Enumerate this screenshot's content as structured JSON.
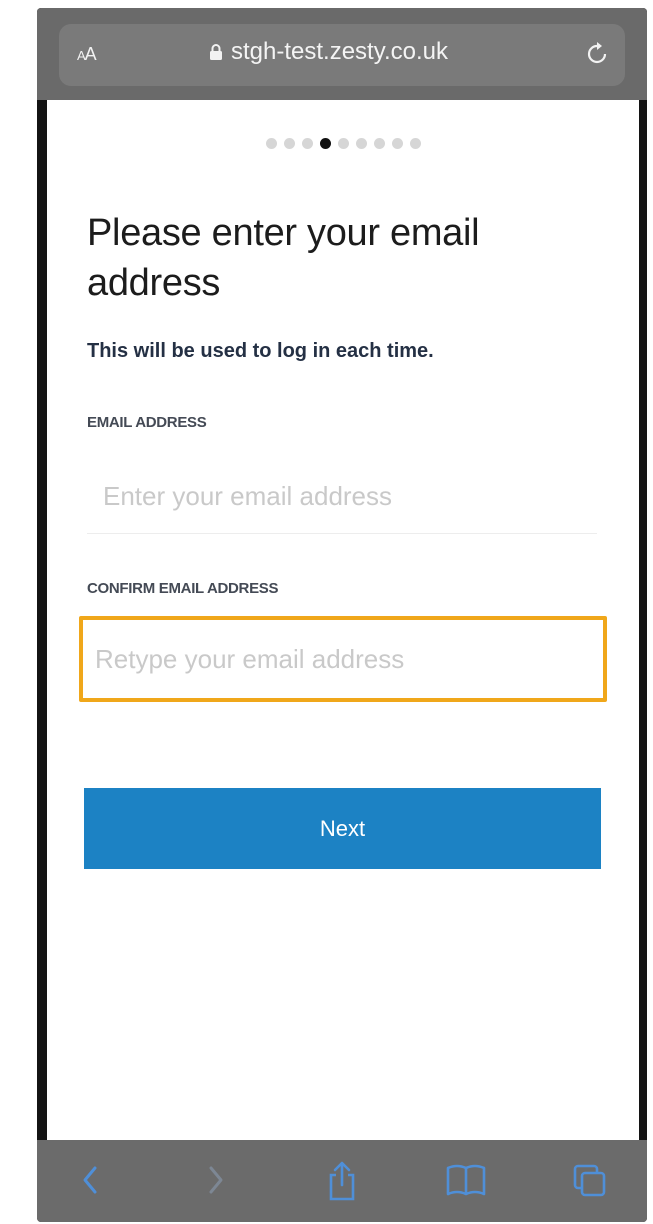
{
  "browser": {
    "text_size_label_small": "A",
    "text_size_label_large": "A",
    "url": "stgh-test.zesty.co.uk",
    "icons": [
      "lock-icon",
      "reload-icon",
      "back-icon",
      "forward-icon",
      "share-icon",
      "bookmarks-icon",
      "tabs-icon"
    ]
  },
  "progress": {
    "total_steps": 9,
    "current_step": 4
  },
  "form": {
    "title": "Please enter your email address",
    "subtitle": "This will be used to log in each time.",
    "email_label": "EMAIL ADDRESS",
    "email_placeholder": "Enter your email address",
    "email_value": "",
    "confirm_label": "CONFIRM EMAIL ADDRESS",
    "confirm_placeholder": "Retype your email address",
    "confirm_value": "",
    "next_label": "Next"
  },
  "colors": {
    "primary_button": "#1c82c4",
    "focus_outline": "#f0a71a",
    "browser_chrome": "#6a6a6a",
    "toolbar_icon_active": "#4f8fd8"
  }
}
